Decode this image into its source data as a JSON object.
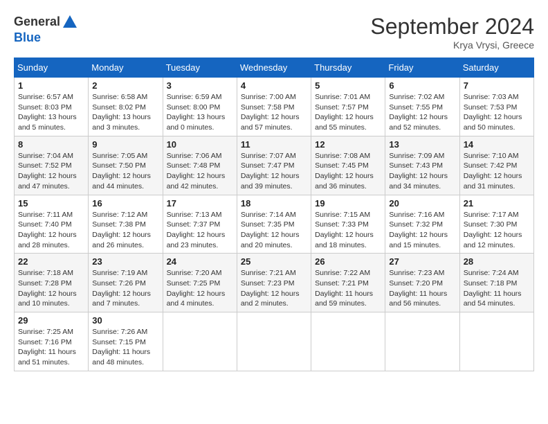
{
  "header": {
    "logo_line1": "General",
    "logo_line2": "Blue",
    "month": "September 2024",
    "location": "Krya Vrysi, Greece"
  },
  "weekdays": [
    "Sunday",
    "Monday",
    "Tuesday",
    "Wednesday",
    "Thursday",
    "Friday",
    "Saturday"
  ],
  "weeks": [
    [
      {
        "day": "1",
        "sunrise": "Sunrise: 6:57 AM",
        "sunset": "Sunset: 8:03 PM",
        "daylight": "Daylight: 13 hours and 5 minutes."
      },
      {
        "day": "2",
        "sunrise": "Sunrise: 6:58 AM",
        "sunset": "Sunset: 8:02 PM",
        "daylight": "Daylight: 13 hours and 3 minutes."
      },
      {
        "day": "3",
        "sunrise": "Sunrise: 6:59 AM",
        "sunset": "Sunset: 8:00 PM",
        "daylight": "Daylight: 13 hours and 0 minutes."
      },
      {
        "day": "4",
        "sunrise": "Sunrise: 7:00 AM",
        "sunset": "Sunset: 7:58 PM",
        "daylight": "Daylight: 12 hours and 57 minutes."
      },
      {
        "day": "5",
        "sunrise": "Sunrise: 7:01 AM",
        "sunset": "Sunset: 7:57 PM",
        "daylight": "Daylight: 12 hours and 55 minutes."
      },
      {
        "day": "6",
        "sunrise": "Sunrise: 7:02 AM",
        "sunset": "Sunset: 7:55 PM",
        "daylight": "Daylight: 12 hours and 52 minutes."
      },
      {
        "day": "7",
        "sunrise": "Sunrise: 7:03 AM",
        "sunset": "Sunset: 7:53 PM",
        "daylight": "Daylight: 12 hours and 50 minutes."
      }
    ],
    [
      {
        "day": "8",
        "sunrise": "Sunrise: 7:04 AM",
        "sunset": "Sunset: 7:52 PM",
        "daylight": "Daylight: 12 hours and 47 minutes."
      },
      {
        "day": "9",
        "sunrise": "Sunrise: 7:05 AM",
        "sunset": "Sunset: 7:50 PM",
        "daylight": "Daylight: 12 hours and 44 minutes."
      },
      {
        "day": "10",
        "sunrise": "Sunrise: 7:06 AM",
        "sunset": "Sunset: 7:48 PM",
        "daylight": "Daylight: 12 hours and 42 minutes."
      },
      {
        "day": "11",
        "sunrise": "Sunrise: 7:07 AM",
        "sunset": "Sunset: 7:47 PM",
        "daylight": "Daylight: 12 hours and 39 minutes."
      },
      {
        "day": "12",
        "sunrise": "Sunrise: 7:08 AM",
        "sunset": "Sunset: 7:45 PM",
        "daylight": "Daylight: 12 hours and 36 minutes."
      },
      {
        "day": "13",
        "sunrise": "Sunrise: 7:09 AM",
        "sunset": "Sunset: 7:43 PM",
        "daylight": "Daylight: 12 hours and 34 minutes."
      },
      {
        "day": "14",
        "sunrise": "Sunrise: 7:10 AM",
        "sunset": "Sunset: 7:42 PM",
        "daylight": "Daylight: 12 hours and 31 minutes."
      }
    ],
    [
      {
        "day": "15",
        "sunrise": "Sunrise: 7:11 AM",
        "sunset": "Sunset: 7:40 PM",
        "daylight": "Daylight: 12 hours and 28 minutes."
      },
      {
        "day": "16",
        "sunrise": "Sunrise: 7:12 AM",
        "sunset": "Sunset: 7:38 PM",
        "daylight": "Daylight: 12 hours and 26 minutes."
      },
      {
        "day": "17",
        "sunrise": "Sunrise: 7:13 AM",
        "sunset": "Sunset: 7:37 PM",
        "daylight": "Daylight: 12 hours and 23 minutes."
      },
      {
        "day": "18",
        "sunrise": "Sunrise: 7:14 AM",
        "sunset": "Sunset: 7:35 PM",
        "daylight": "Daylight: 12 hours and 20 minutes."
      },
      {
        "day": "19",
        "sunrise": "Sunrise: 7:15 AM",
        "sunset": "Sunset: 7:33 PM",
        "daylight": "Daylight: 12 hours and 18 minutes."
      },
      {
        "day": "20",
        "sunrise": "Sunrise: 7:16 AM",
        "sunset": "Sunset: 7:32 PM",
        "daylight": "Daylight: 12 hours and 15 minutes."
      },
      {
        "day": "21",
        "sunrise": "Sunrise: 7:17 AM",
        "sunset": "Sunset: 7:30 PM",
        "daylight": "Daylight: 12 hours and 12 minutes."
      }
    ],
    [
      {
        "day": "22",
        "sunrise": "Sunrise: 7:18 AM",
        "sunset": "Sunset: 7:28 PM",
        "daylight": "Daylight: 12 hours and 10 minutes."
      },
      {
        "day": "23",
        "sunrise": "Sunrise: 7:19 AM",
        "sunset": "Sunset: 7:26 PM",
        "daylight": "Daylight: 12 hours and 7 minutes."
      },
      {
        "day": "24",
        "sunrise": "Sunrise: 7:20 AM",
        "sunset": "Sunset: 7:25 PM",
        "daylight": "Daylight: 12 hours and 4 minutes."
      },
      {
        "day": "25",
        "sunrise": "Sunrise: 7:21 AM",
        "sunset": "Sunset: 7:23 PM",
        "daylight": "Daylight: 12 hours and 2 minutes."
      },
      {
        "day": "26",
        "sunrise": "Sunrise: 7:22 AM",
        "sunset": "Sunset: 7:21 PM",
        "daylight": "Daylight: 11 hours and 59 minutes."
      },
      {
        "day": "27",
        "sunrise": "Sunrise: 7:23 AM",
        "sunset": "Sunset: 7:20 PM",
        "daylight": "Daylight: 11 hours and 56 minutes."
      },
      {
        "day": "28",
        "sunrise": "Sunrise: 7:24 AM",
        "sunset": "Sunset: 7:18 PM",
        "daylight": "Daylight: 11 hours and 54 minutes."
      }
    ],
    [
      {
        "day": "29",
        "sunrise": "Sunrise: 7:25 AM",
        "sunset": "Sunset: 7:16 PM",
        "daylight": "Daylight: 11 hours and 51 minutes."
      },
      {
        "day": "30",
        "sunrise": "Sunrise: 7:26 AM",
        "sunset": "Sunset: 7:15 PM",
        "daylight": "Daylight: 11 hours and 48 minutes."
      },
      null,
      null,
      null,
      null,
      null
    ]
  ]
}
